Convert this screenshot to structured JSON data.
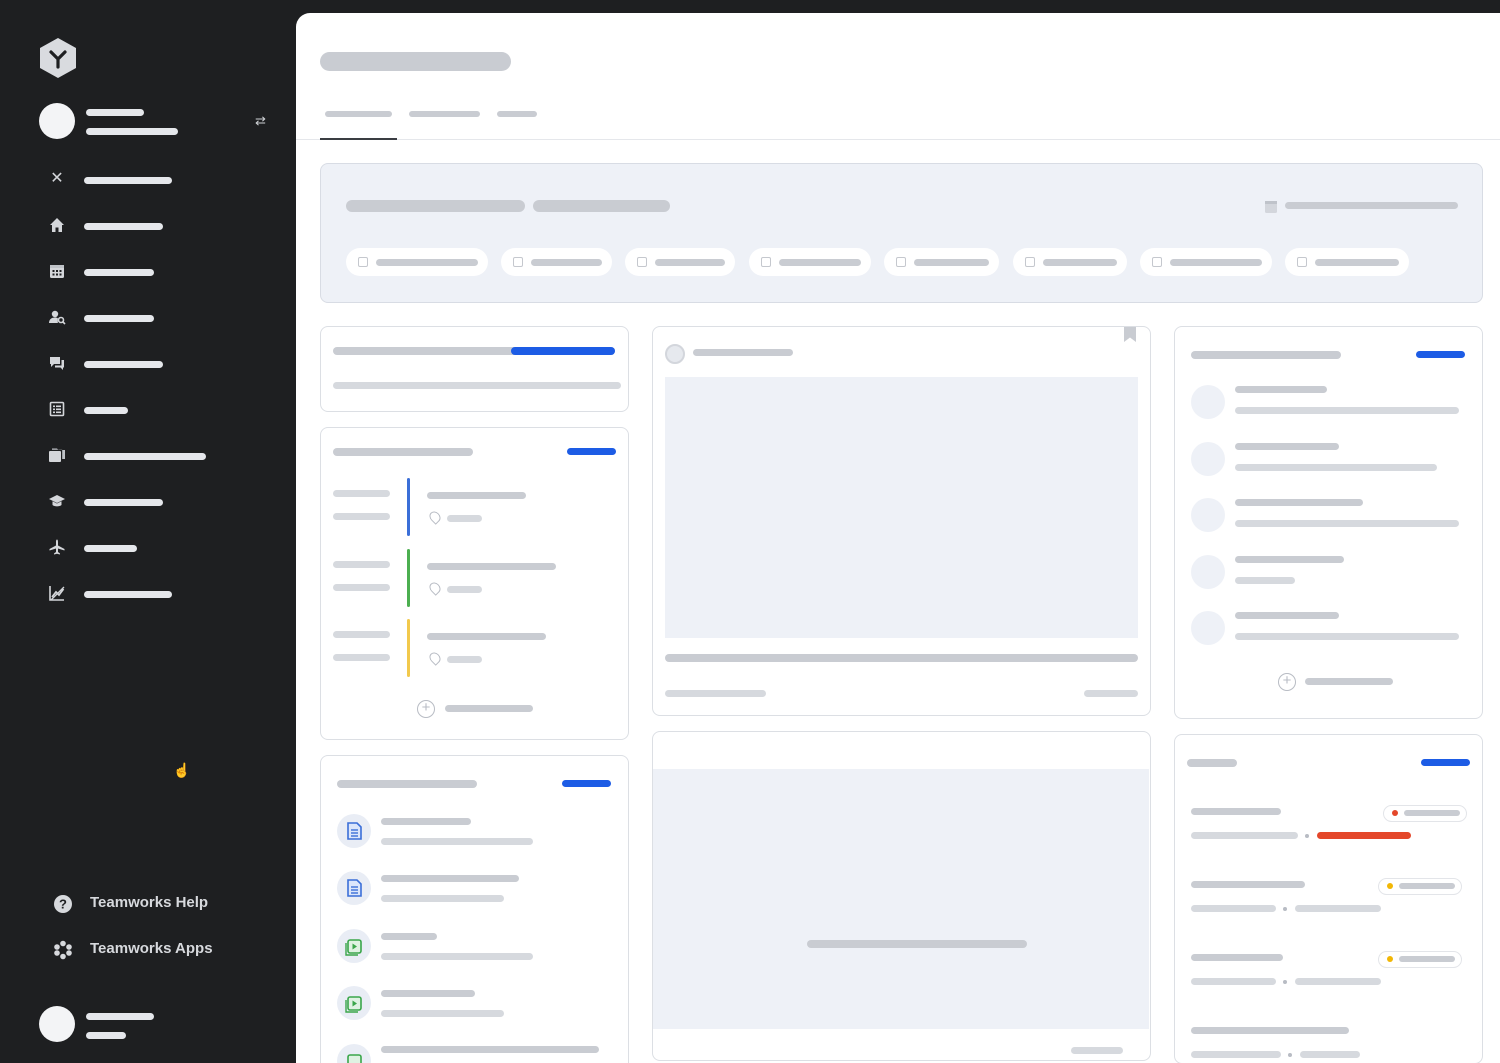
{
  "sidebar": {
    "icons": [
      "logo-icon",
      "switch-account-icon",
      "close-icon",
      "home-icon",
      "calendar-icon",
      "user-search-icon",
      "chat-icon",
      "list-icon",
      "folder-icon",
      "academic-cap-icon",
      "airplane-icon",
      "chart-icon"
    ],
    "help_label": "Teamworks Help",
    "apps_label": "Teamworks Apps"
  },
  "colors": {
    "sidebar_bg": "#1e1f21",
    "accent": "#1d5ce5",
    "skeleton": "#c9ccd2",
    "panel_bg": "#eef1f7",
    "event_blue": "#3b6fd8",
    "event_green": "#4caf50",
    "event_yellow": "#f2c94c",
    "status_red": "#e4472a",
    "status_yellow": "#f2b705"
  }
}
